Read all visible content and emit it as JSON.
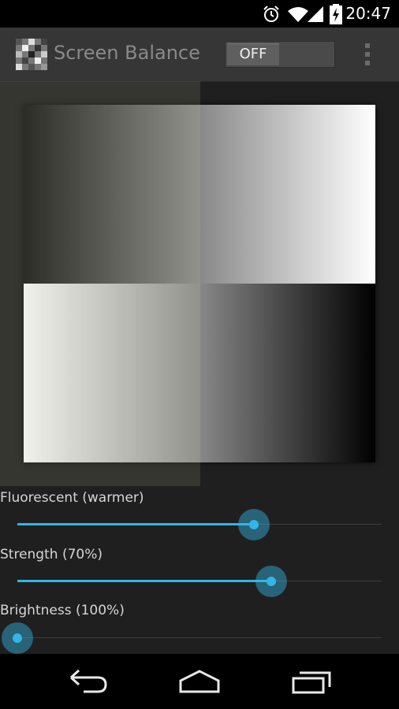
{
  "status_bar": {
    "time": "20:47",
    "icons": [
      "alarm-icon",
      "wifi-icon",
      "signal-icon",
      "battery-charging-icon"
    ]
  },
  "action_bar": {
    "title": "Screen Balance",
    "toggle_label": "OFF",
    "overflow_icon": "overflow-menu-icon"
  },
  "preview": {
    "tint_color": "#e2ddaa"
  },
  "controls": {
    "temperature": {
      "label": "Fluorescent (warmer)",
      "value": 0.649
    },
    "strength": {
      "label": "Strength (70%)",
      "value": 0.697
    },
    "brightness": {
      "label": "Brightness (100%)",
      "value": 0.0
    }
  },
  "navigation": {
    "icons": [
      "back-icon",
      "home-icon",
      "recent-apps-icon"
    ]
  },
  "colors": {
    "accent": "#33b5e5",
    "action_bar": "#363636",
    "background": "#1f1f1f"
  }
}
